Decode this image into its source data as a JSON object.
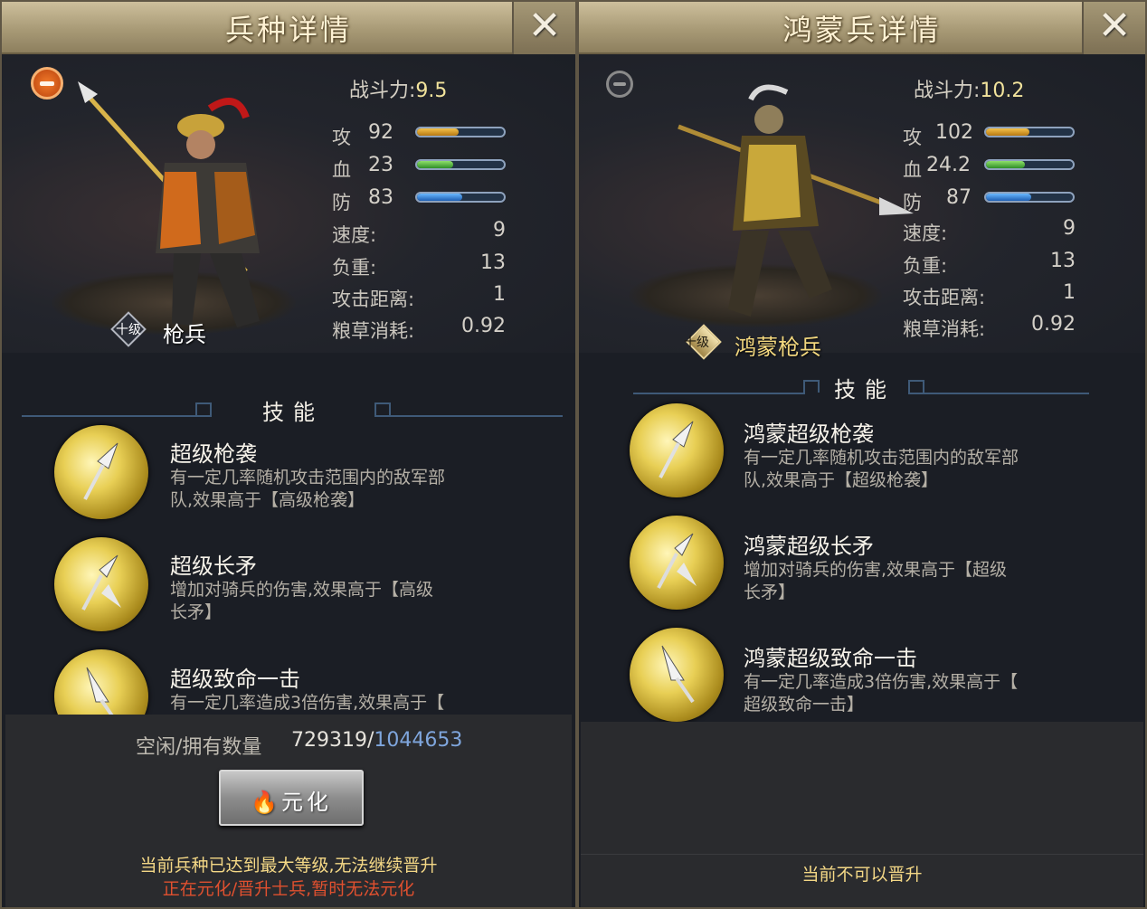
{
  "left": {
    "title": "兵种详情",
    "close_icon": "close-x-icon",
    "power_label": "战斗力:",
    "power_value": "9.5",
    "stats": {
      "attack_label": "攻",
      "attack_value": "92",
      "attack_fill": 0.48,
      "hp_label": "血",
      "hp_value": "23",
      "hp_fill": 0.42,
      "def_label": "防",
      "def_value": "83",
      "def_fill": 0.52,
      "speed_label": "速度:",
      "speed_value": "9",
      "load_label": "负重:",
      "load_value": "13",
      "range_label": "攻击距离:",
      "range_value": "1",
      "food_label": "粮草消耗:",
      "food_value": "0.92"
    },
    "unit_level": "十级",
    "unit_name": "枪兵",
    "skills_title": "技能",
    "skills": [
      {
        "name": "超级枪袭",
        "desc1": "有一定几率随机攻击范围内的敌军部",
        "desc2": "队,效果高于【高级枪袭】"
      },
      {
        "name": "超级长矛",
        "desc1": "增加对骑兵的伤害,效果高于【高级",
        "desc2": "长矛】"
      },
      {
        "name": "超级致命一击",
        "desc1": "有一定几率造成3倍伤害,效果高于【",
        "desc2": ""
      }
    ],
    "count_label": "空闲/拥有数量",
    "count_idle": "729319/",
    "count_total": "1044653",
    "button_label": "元化",
    "note1": "当前兵种已达到最大等级,无法继续晋升",
    "note2": "正在元化/晋升士兵,暂时无法元化"
  },
  "right": {
    "title": "鸿蒙兵详情",
    "close_icon": "close-x-icon",
    "power_label": "战斗力:",
    "power_value": "10.2",
    "stats": {
      "attack_label": "攻",
      "attack_value": "102",
      "attack_fill": 0.5,
      "hp_label": "血",
      "hp_value": "24.2",
      "hp_fill": 0.45,
      "def_label": "防",
      "def_value": "87",
      "def_fill": 0.52,
      "speed_label": "速度:",
      "speed_value": "9",
      "load_label": "负重:",
      "load_value": "13",
      "range_label": "攻击距离:",
      "range_value": "1",
      "food_label": "粮草消耗:",
      "food_value": "0.92"
    },
    "unit_level": "十级",
    "unit_name": "鸿蒙枪兵",
    "skills_title": "技能",
    "skills": [
      {
        "name": "鸿蒙超级枪袭",
        "desc1": "有一定几率随机攻击范围内的敌军部",
        "desc2": "队,效果高于【超级枪袭】"
      },
      {
        "name": "鸿蒙超级长矛",
        "desc1": "增加对骑兵的伤害,效果高于【超级",
        "desc2": "长矛】"
      },
      {
        "name": "鸿蒙超级致命一击",
        "desc1": "有一定几率造成3倍伤害,效果高于【",
        "desc2": "超级致命一击】"
      }
    ],
    "note1": "当前不可以晋升"
  },
  "colors": {
    "gold_text": "#f2e39c",
    "blue_total": "#7fa6dd",
    "note_gold": "#f4d886",
    "note_red": "#e0502f"
  }
}
